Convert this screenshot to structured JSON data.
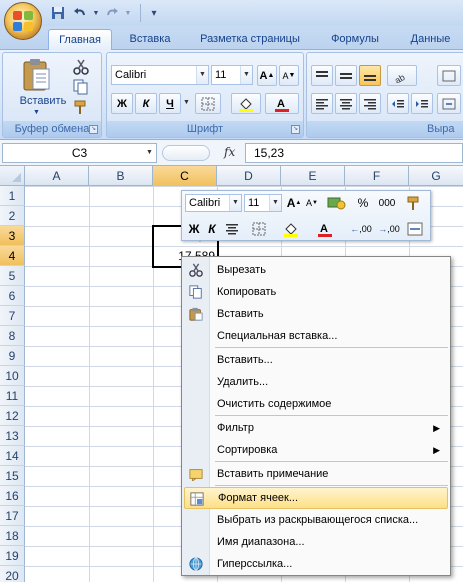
{
  "quick_access": {
    "save": "save-icon",
    "undo": "undo-icon",
    "redo": "redo-icon",
    "customize": "▾"
  },
  "tabs": [
    {
      "label": "Главная",
      "active": true
    },
    {
      "label": "Вставка",
      "active": false
    },
    {
      "label": "Разметка страницы",
      "active": false
    },
    {
      "label": "Формулы",
      "active": false
    },
    {
      "label": "Данные",
      "active": false
    }
  ],
  "ribbon": {
    "clipboard": {
      "label": "Буфер обмена",
      "paste": "Вставить"
    },
    "font": {
      "label": "Шрифт",
      "font_name": "Calibri",
      "font_size": "11",
      "bold": "Ж",
      "italic": "К",
      "underline": "Ч",
      "grow": "A",
      "shrink": "A"
    },
    "alignment": {
      "label": "Выра"
    }
  },
  "formula_bar": {
    "name_box": "C3",
    "fx": "fx",
    "value": "15,23"
  },
  "columns": [
    "A",
    "B",
    "C",
    "D",
    "E",
    "F",
    "G"
  ],
  "selected_column": "C",
  "rows": [
    "1",
    "2",
    "3",
    "4",
    "5",
    "6",
    "7",
    "8",
    "9",
    "10",
    "11",
    "12",
    "13",
    "14",
    "15",
    "16",
    "17",
    "18",
    "19",
    "20"
  ],
  "selected_rows": [
    "3",
    "4"
  ],
  "cells": {
    "C3": "15,23",
    "C4": "17,589"
  },
  "mini_toolbar": {
    "font_name": "Calibri",
    "font_size": "11",
    "percent": "%",
    "thousands": "000",
    "bold": "Ж",
    "italic": "К",
    "increase_decimal": ",00",
    "decrease_decimal": ",00"
  },
  "context_menu": {
    "items": [
      {
        "label": "Вырезать",
        "icon": "scissors-icon"
      },
      {
        "label": "Копировать",
        "icon": "copy-icon"
      },
      {
        "label": "Вставить",
        "icon": "paste-icon"
      },
      {
        "label": "Специальная вставка...",
        "icon": ""
      },
      {
        "label": "Вставить...",
        "icon": ""
      },
      {
        "label": "Удалить...",
        "icon": ""
      },
      {
        "label": "Очистить содержимое",
        "icon": ""
      },
      {
        "label": "Фильтр",
        "icon": "",
        "submenu": true
      },
      {
        "label": "Сортировка",
        "icon": "",
        "submenu": true
      },
      {
        "label": "Вставить примечание",
        "icon": "comment-icon"
      },
      {
        "label": "Формат ячеек...",
        "icon": "format-cells-icon",
        "highlighted": true
      },
      {
        "label": "Выбрать из раскрывающегося списка...",
        "icon": ""
      },
      {
        "label": "Имя диапазона...",
        "icon": ""
      },
      {
        "label": "Гиперссылка...",
        "icon": "hyperlink-icon"
      }
    ]
  },
  "colors": {
    "highlight": "#fddf86",
    "ribbon": "#d9e6f7",
    "selected_header": "#f1c05c"
  }
}
